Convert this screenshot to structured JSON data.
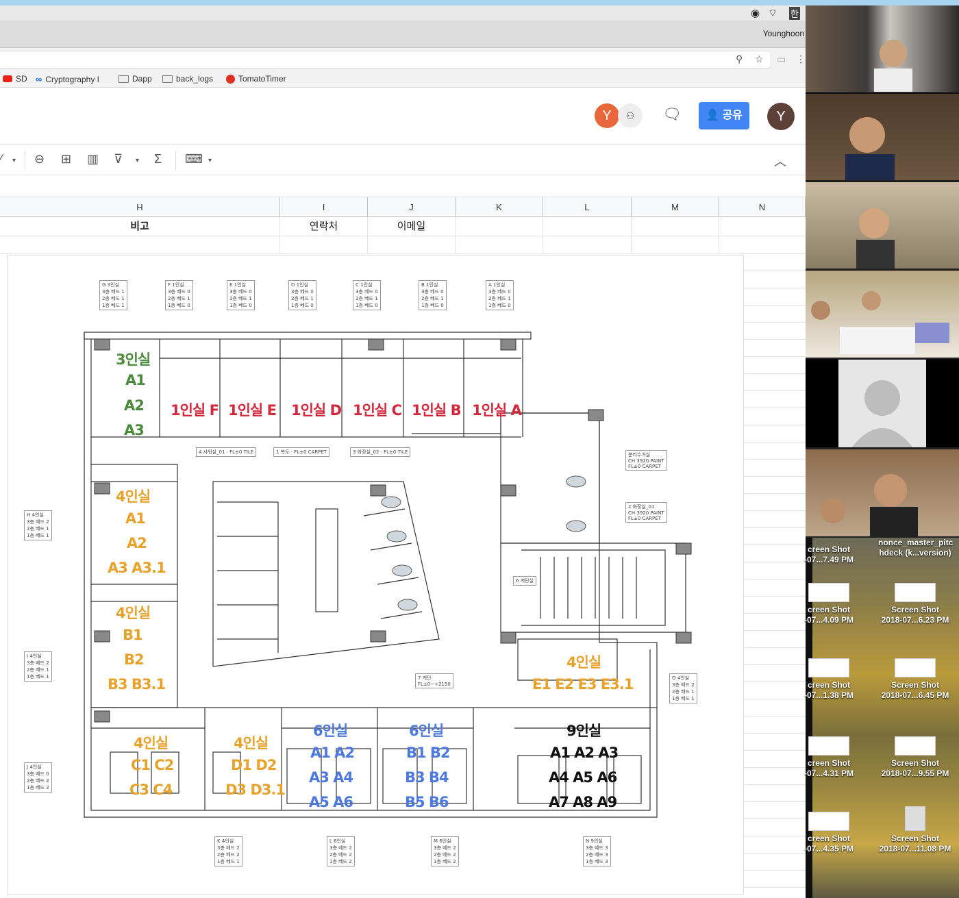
{
  "browser": {
    "profile_name": "Younghoon",
    "bookmarks": [
      {
        "label": "SD",
        "icon": "youtube-icon"
      },
      {
        "label": "Cryptography I",
        "icon": "coursera-link-icon"
      },
      {
        "label": "Dapp",
        "icon": "folder-icon"
      },
      {
        "label": "back_logs",
        "icon": "folder-icon"
      },
      {
        "label": "TomatoTimer",
        "icon": "tomato-icon"
      }
    ]
  },
  "sheet": {
    "share_label": "공유",
    "avatar_collaborator": "Y",
    "avatar_user": "Y",
    "columns": [
      "H",
      "I",
      "J",
      "K",
      "L",
      "M",
      "N"
    ],
    "row1": {
      "H": "비고",
      "I": "연락처",
      "J": "이메일"
    }
  },
  "floorplan": {
    "rooms": {
      "g3": {
        "title": "3인실",
        "beds": [
          "A1",
          "A2",
          "A3"
        ]
      },
      "f": "1인실 F",
      "e": "1인실 E",
      "d": "1인실 D",
      "c": "1인실 C",
      "b": "1인실 B",
      "a": "1인실 A",
      "h4": {
        "title": "4인실",
        "lines": [
          "A1",
          "A2",
          "A3 A3.1"
        ]
      },
      "i4": {
        "title": "4인실",
        "lines": [
          "B1",
          "B2",
          "B3 B3.1"
        ]
      },
      "o4": {
        "title": "4인실",
        "lines": [
          "E1  E2 E3 E3.1"
        ]
      },
      "j4": {
        "title": "4인실",
        "lines": [
          "C1 C2",
          "C3 C4"
        ]
      },
      "k4": {
        "title": "4인실",
        "lines": [
          "D1 D2",
          "D3 D3.1"
        ]
      },
      "l6": {
        "title": "6인실",
        "lines": [
          "A1 A2",
          "A3 A4",
          "A5 A6"
        ]
      },
      "m6": {
        "title": "6인실",
        "lines": [
          "B1 B2",
          "B3 B4",
          "B5 B6"
        ]
      },
      "n9": {
        "title": "9인실",
        "lines": [
          "A1 A2 A3",
          "A4 A5 A6",
          "A7 A8 A9"
        ]
      }
    },
    "top_tags": [
      {
        "code": "G",
        "name": "3인실",
        "r3": "1",
        "r2": "1",
        "r1": "1"
      },
      {
        "code": "F",
        "name": "1인실",
        "r3": "0",
        "r2": "1",
        "r1": "0"
      },
      {
        "code": "E",
        "name": "1인실",
        "r3": "0",
        "r2": "1",
        "r1": "0"
      },
      {
        "code": "D",
        "name": "1인실",
        "r3": "0",
        "r2": "1",
        "r1": "0"
      },
      {
        "code": "C",
        "name": "1인실",
        "r3": "0",
        "r2": "1",
        "r1": "0"
      },
      {
        "code": "B",
        "name": "1인실",
        "r3": "0",
        "r2": "1",
        "r1": "0"
      },
      {
        "code": "A",
        "name": "1인실",
        "r3": "0",
        "r2": "1",
        "r1": "0"
      }
    ],
    "side_tags": [
      {
        "code": "H",
        "name": "4인실",
        "r3": "2",
        "r2": "1",
        "r1": "1"
      },
      {
        "code": "I",
        "name": "4인실",
        "r3": "2",
        "r2": "1",
        "r1": "1"
      },
      {
        "code": "J",
        "name": "4인실",
        "r3": "0",
        "r2": "2",
        "r1": "2"
      },
      {
        "code": "O",
        "name": "4인실",
        "r3": "2",
        "r2": "1",
        "r1": "1"
      }
    ],
    "bottom_tags": [
      {
        "code": "K",
        "name": "4인실",
        "r3": "2",
        "r2": "2",
        "r1": "1"
      },
      {
        "code": "L",
        "name": "6인실",
        "r3": "2",
        "r2": "2",
        "r1": "2"
      },
      {
        "code": "M",
        "name": "6인실",
        "r3": "2",
        "r2": "2",
        "r1": "2"
      },
      {
        "code": "N",
        "name": "9인실",
        "r3": "3",
        "r2": "3",
        "r1": "3"
      }
    ],
    "bed_row_labels": {
      "r3": "3층 베드",
      "r2": "2층 베드",
      "r1": "1층 베드"
    },
    "area_tags": {
      "shower": "4  샤워실_01",
      "hall": "1  복도",
      "toilet02": "3  화장실_02",
      "fl": "FL±0",
      "tile": "TILE",
      "carpet": "CARPET",
      "recycle": "분리수거실",
      "toilet01": "2  화장실_01",
      "ch": "CH 3920",
      "paint": "PAINT",
      "stair_room": "6  계단실",
      "stair": "7  계단",
      "stair_fl": "FL±0~+2150"
    }
  },
  "desktop_icons": [
    {
      "label": "creen Shot",
      "sub": "-07...7.49 PM"
    },
    {
      "label": "nonce_master_pitc",
      "sub": "hdeck (k...version)"
    },
    {
      "label": "creen Shot",
      "sub": "-07...4.09 PM"
    },
    {
      "label": "Screen Shot",
      "sub": "2018-07...6.23 PM"
    },
    {
      "label": "creen Shot",
      "sub": "-07...1.38 PM"
    },
    {
      "label": "Screen Shot",
      "sub": "2018-07...6.45 PM"
    },
    {
      "label": "creen Shot",
      "sub": "-07...4.31 PM"
    },
    {
      "label": "Screen Shot",
      "sub": "2018-07...9.55 PM"
    },
    {
      "label": "creen Shot",
      "sub": "-07...4.35 PM"
    },
    {
      "label": "Screen Shot",
      "sub": "2018-07...11.08 PM"
    }
  ],
  "colors": {
    "share": "#4285f4",
    "red_room": "#d2283c",
    "orange_room": "#e8a22c",
    "blue_room": "#4d78dd",
    "green_room": "#4a8a3a"
  }
}
